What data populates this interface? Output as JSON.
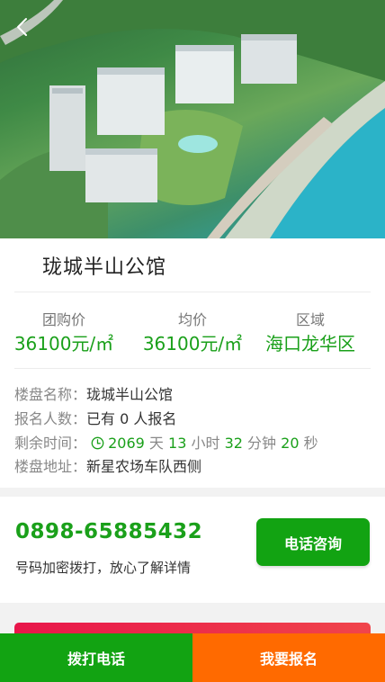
{
  "property": {
    "title": "珑城半山公馆"
  },
  "stats": [
    {
      "label": "团购价",
      "value": "36100元/㎡"
    },
    {
      "label": "均价",
      "value": "36100元/㎡"
    },
    {
      "label": "区域",
      "value": "海口龙华区"
    }
  ],
  "info": {
    "name_label": "楼盘名称：",
    "name_value": "珑城半山公馆",
    "signup_label": "报名人数：",
    "signup_value": "已有 0 人报名",
    "time_label": "剩余时间：",
    "countdown": {
      "days": "2069",
      "days_unit": "天",
      "hours": "13",
      "hours_unit": "小时",
      "minutes": "32",
      "minutes_unit": "分钟",
      "seconds": "20",
      "seconds_unit": "秒"
    },
    "address_label": "楼盘地址：",
    "address_value": "新星农场车队西侧"
  },
  "contact": {
    "phone": "0898-65885432",
    "note": "号码加密拨打，放心了解详情",
    "consult_button": "电话咨询"
  },
  "bottom_bar": {
    "call_label": "拨打电话",
    "signup_label": "我要报名"
  },
  "icons": {
    "back": "chevron-left-icon",
    "clock": "clock-icon"
  },
  "colors": {
    "accent_green": "#1aa01a",
    "button_green": "#12a312",
    "signup_orange": "#ff6a00",
    "banner_red": "#e8164a"
  }
}
